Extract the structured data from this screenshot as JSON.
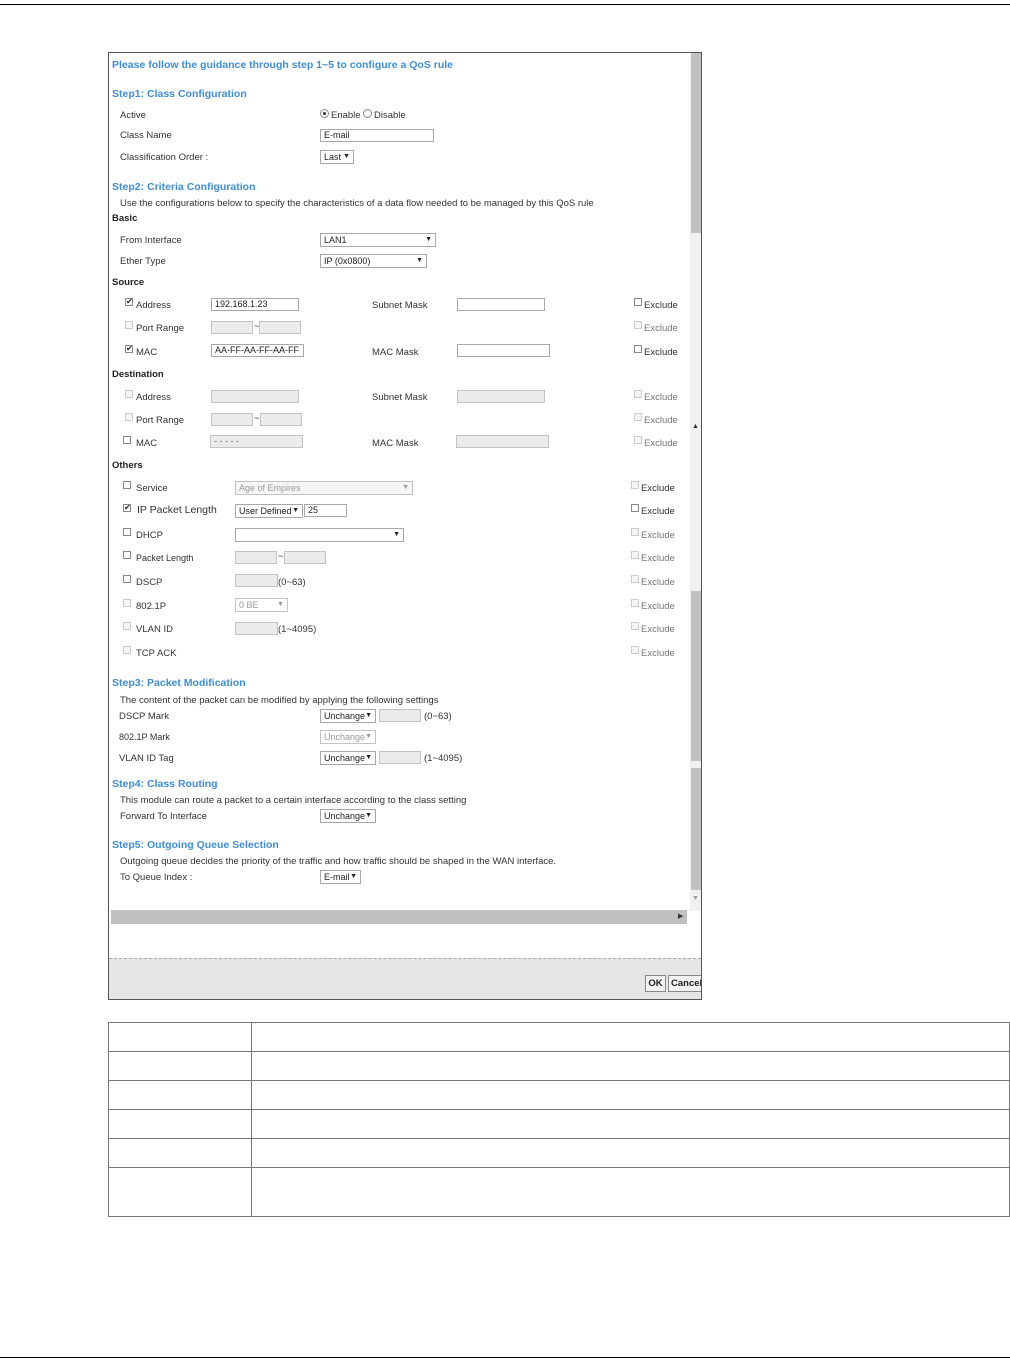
{
  "title": "Please follow the guidance through step 1~5 to configure a QoS rule",
  "step1": {
    "heading": "Step1: Class Configuration",
    "active_label": "Active",
    "enable_label": "Enable",
    "disable_label": "Disable",
    "class_name_label": "Class Name",
    "class_name_value": "E-mail",
    "order_label": "Classification Order :",
    "order_value": "Last"
  },
  "step2": {
    "heading": "Step2: Criteria Configuration",
    "description": "Use the configurations below to specify the characteristics of a data flow needed to be managed by this QoS rule",
    "basic_label": "Basic",
    "from_interface_label": "From Interface",
    "from_interface_value": "LAN1",
    "ether_type_label": "Ether Type",
    "ether_type_value": "IP (0x0800)",
    "source_label": "Source",
    "destination_label": "Destination",
    "others_label": "Others",
    "exclude_label": "Exclude",
    "address_label": "Address",
    "subnet_mask_label": "Subnet Mask",
    "port_range_label": "Port Range",
    "mac_label": "MAC",
    "mac_mask_label": "MAC Mask",
    "tilde": "~",
    "src_address_value": "192.168.1.23",
    "src_mac_value": "AA-FF-AA-FF-AA-FF",
    "dst_mac_value": "-   -   -   -   -",
    "service_label": "Service",
    "service_value": "Age of Empires",
    "ip_packet_length_label": "IP Packet Length",
    "ip_packet_length_mode": "User Defined",
    "ip_packet_length_value": "25",
    "dhcp_label": "DHCP",
    "packet_length_label": "Packet Length",
    "dscp_label": "DSCP",
    "dscp_range": "(0~63)",
    "p8021_label": "802.1P",
    "p8021_value": "0 BE",
    "vlan_id_label": "VLAN ID",
    "vlan_range": "(1~4095)",
    "tcp_ack_label": "TCP ACK"
  },
  "step3": {
    "heading": "Step3: Packet Modification",
    "description": "The content of the packet can be modified by applying the following settings",
    "dscp_mark_label": "DSCP Mark",
    "dscp_mark_value": "Unchange",
    "dscp_range": "(0~63)",
    "p8021_mark_label": "802.1P Mark",
    "p8021_mark_value": "Unchange",
    "vlan_tag_label": "VLAN ID Tag",
    "vlan_tag_value": "Unchange",
    "vlan_range": "(1~4095)"
  },
  "step4": {
    "heading": "Step4: Class Routing",
    "description": "This module can route a packet to a certain interface according to the class setting",
    "forward_label": "Forward To Interface",
    "forward_value": "Unchange"
  },
  "step5": {
    "heading": "Step5: Outgoing Queue Selection",
    "description": "Outgoing queue decides the priority of the traffic and how traffic should be shaped in the WAN interface.",
    "queue_label": "To Queue Index :",
    "queue_value": "E-mail"
  },
  "buttons": {
    "ok": "OK",
    "cancel": "Cancel"
  },
  "icons": {
    "checkbox_checked": "✔",
    "dropdown_arrow": "▼",
    "scroll_up": "▲",
    "scroll_down": "▼",
    "scroll_right": "▶"
  }
}
